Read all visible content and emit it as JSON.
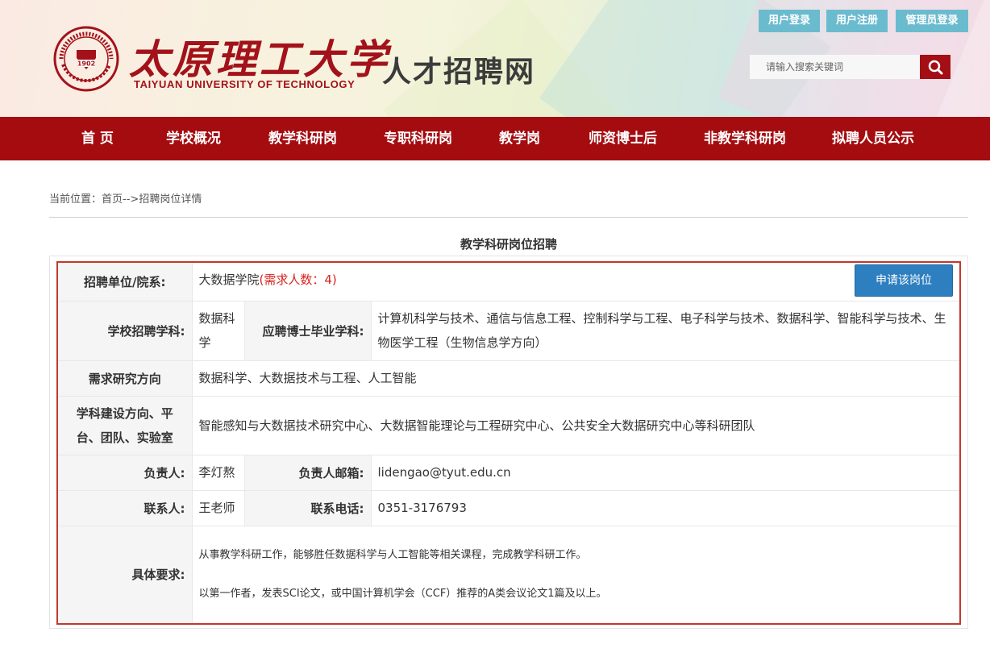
{
  "header": {
    "school_name_cn": "太原理工大学",
    "school_name_en": "TAIYUAN UNIVERSITY OF TECHNOLOGY",
    "site_title": "人才招聘网",
    "seal_year": "1902",
    "buttons": {
      "user_login": "用户登录",
      "user_register": "用户注册",
      "admin_login": "管理员登录"
    },
    "search": {
      "placeholder": "请输入搜索关键词",
      "icon": "search-icon"
    }
  },
  "nav": {
    "items": [
      {
        "label": "首 页"
      },
      {
        "label": "学校概况"
      },
      {
        "label": "教学科研岗"
      },
      {
        "label": "专职科研岗"
      },
      {
        "label": "教学岗"
      },
      {
        "label": "师资博士后"
      },
      {
        "label": "非教学科研岗"
      },
      {
        "label": "拟聘人员公示"
      }
    ]
  },
  "breadcrumb": {
    "prefix": "当前位置：",
    "home": "首页",
    "separator": "-->",
    "current": "招聘岗位详情"
  },
  "section_title": "教学科研岗位招聘",
  "detail": {
    "unit_label": "招聘单位/院系:",
    "unit_value": "大数据学院",
    "headcount": "(需求人数：4)",
    "apply_button": "申请该岗位",
    "discipline_label": "学校招聘学科:",
    "discipline_value": "数据科学",
    "phd_label": "应聘博士毕业学科:",
    "phd_value": "计算机科学与技术、通信与信息工程、控制科学与工程、电子科学与技术、数据科学、智能科学与技术、生物医学工程（生物信息学方向）",
    "research_label": "需求研究方向",
    "research_value": "数据科学、大数据技术与工程、人工智能",
    "platform_label": "学科建设方向、平台、团队、实验室",
    "platform_value": "智能感知与大数据技术研究中心、大数据智能理论与工程研究中心、公共安全大数据研究中心等科研团队",
    "leader_label": "负责人:",
    "leader_value": "李灯熬",
    "email_label": "负责人邮箱:",
    "email_value": "lidengao@tyut.edu.cn",
    "contact_label": "联系人:",
    "contact_value": "王老师",
    "phone_label": "联系电话:",
    "phone_value": "0351-3176793",
    "requirements_label": "具体要求:",
    "requirements": [
      "从事教学科研工作，能够胜任数据科学与人工智能等相关课程，完成教学科研工作。",
      "以第一作者，发表SCI论文，或中国计算机学会（CCF）推荐的A类会议论文1篇及以上。"
    ]
  },
  "colors": {
    "brand_red": "#a40c10",
    "top_button": "#6bbbcf",
    "apply_button": "#2e7fbf",
    "table_border": "#c0392b",
    "headcount_text": "#d9231d"
  }
}
